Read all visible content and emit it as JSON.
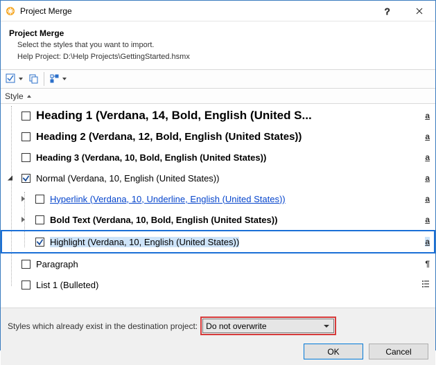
{
  "window": {
    "title": "Project Merge"
  },
  "instruction": {
    "heading": "Project Merge",
    "line1": "Select the styles that you want to import.",
    "line2": "Help Project: D:\\Help Projects\\GettingStarted.hsmx"
  },
  "column_header": "Style",
  "styles": [
    {
      "label": "Heading 1 (Verdana, 14, Bold, English (United S...",
      "glyph": "a",
      "checked": false,
      "css": "font-size:17px;font-weight:bold;"
    },
    {
      "label": "Heading 2 (Verdana, 12, Bold, English (United States))",
      "glyph": "a",
      "checked": false,
      "css": "font-size:15px;font-weight:bold;"
    },
    {
      "label": "Heading 3 (Verdana, 10, Bold, English (United States))",
      "glyph": "a",
      "checked": false,
      "css": "font-size:13px;font-weight:bold;"
    },
    {
      "label": "Normal (Verdana, 10, English (United States))",
      "glyph": "a",
      "checked": true,
      "css": "font-size:13px;"
    },
    {
      "label": "Hyperlink (Verdana, 10, Underline, English (United States))",
      "glyph": "a",
      "checked": false,
      "css": "font-size:13px;color:#0645cc;text-decoration:underline;"
    },
    {
      "label": "Bold Text (Verdana, 10, Bold, English (United States))",
      "glyph": "a",
      "checked": false,
      "css": "font-size:13px;font-weight:bold;"
    },
    {
      "label": "Highlight (Verdana, 10, English (United States))",
      "glyph": "a",
      "checked": true,
      "css": "font-size:13px;"
    },
    {
      "label": "Paragraph",
      "glyph": "¶",
      "checked": false,
      "css": "font-size:13px;"
    },
    {
      "label": "List 1 (Bulleted)",
      "glyph": "",
      "checked": false,
      "css": "font-size:13px;"
    }
  ],
  "overwrite": {
    "label": "Styles which already exist in the destination project:",
    "value": "Do not overwrite"
  },
  "buttons": {
    "ok": "OK",
    "cancel": "Cancel"
  }
}
